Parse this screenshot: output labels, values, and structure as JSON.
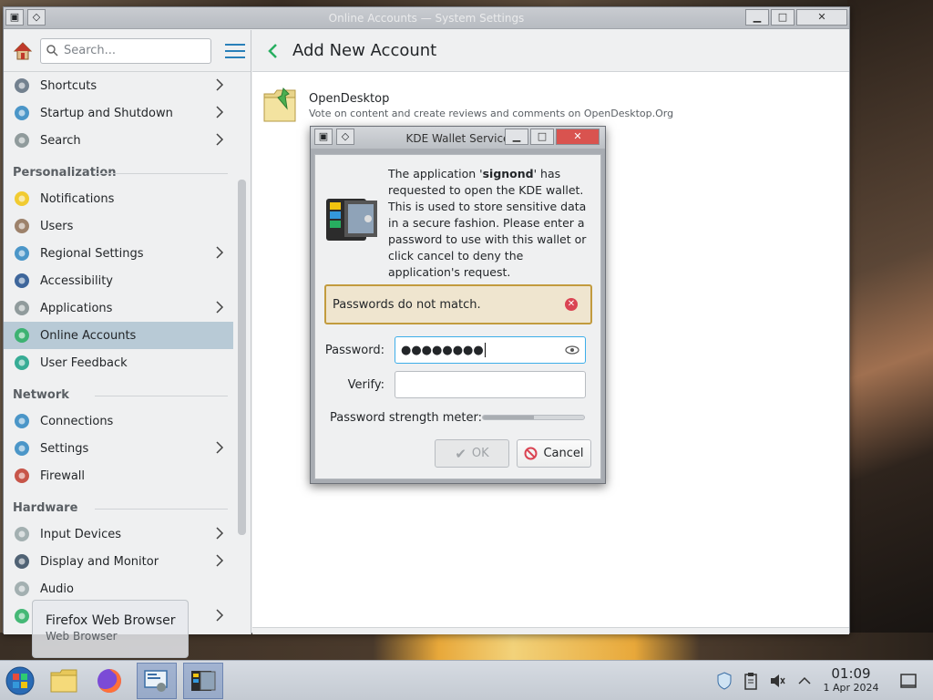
{
  "window": {
    "title": "Online Accounts — System Settings",
    "min_glyph": "▁",
    "max_glyph": "□",
    "close_glyph": "✕"
  },
  "sidebar": {
    "search_placeholder": "Search...",
    "items_top": [
      {
        "label": "Shortcuts",
        "chevron": true,
        "icon": "keyboard-icon"
      },
      {
        "label": "Startup and Shutdown",
        "chevron": true,
        "icon": "startup-icon"
      },
      {
        "label": "Search",
        "chevron": true,
        "icon": "search-icon"
      }
    ],
    "sections": [
      {
        "title": "Personalization",
        "items": [
          {
            "label": "Notifications",
            "chevron": false,
            "icon": "bell-icon"
          },
          {
            "label": "Users",
            "chevron": false,
            "icon": "users-icon"
          },
          {
            "label": "Regional Settings",
            "chevron": true,
            "icon": "globe-icon"
          },
          {
            "label": "Accessibility",
            "chevron": false,
            "icon": "accessibility-icon"
          },
          {
            "label": "Applications",
            "chevron": true,
            "icon": "applications-icon"
          },
          {
            "label": "Online Accounts",
            "chevron": false,
            "icon": "online-accounts-icon",
            "selected": true
          },
          {
            "label": "User Feedback",
            "chevron": false,
            "icon": "feedback-icon"
          }
        ]
      },
      {
        "title": "Network",
        "items": [
          {
            "label": "Connections",
            "chevron": false,
            "icon": "connections-icon"
          },
          {
            "label": "Settings",
            "chevron": true,
            "icon": "network-settings-icon"
          },
          {
            "label": "Firewall",
            "chevron": false,
            "icon": "firewall-icon"
          }
        ]
      },
      {
        "title": "Hardware",
        "items": [
          {
            "label": "Input Devices",
            "chevron": true,
            "icon": "mouse-icon"
          },
          {
            "label": "Display and Monitor",
            "chevron": true,
            "icon": "monitor-icon"
          },
          {
            "label": "Audio",
            "chevron": false,
            "icon": "audio-icon"
          },
          {
            "label": "",
            "chevron": true,
            "icon": "power-icon"
          }
        ]
      }
    ]
  },
  "content": {
    "title": "Add New Account",
    "provider_name": "OpenDesktop",
    "provider_desc": "Vote on content and create reviews and comments on OpenDesktop.Org"
  },
  "dialog": {
    "title": "KDE Wallet Service",
    "text_before": "The application '",
    "app_name": "signond",
    "text_after": "' has requested to open the KDE wallet. This is used to store sensitive data in a secure fashion. Please enter a password to use with this wallet or click cancel to deny the application's request.",
    "error": "Passwords do not match.",
    "password_label": "Password:",
    "password_value": "●●●●●●●●",
    "verify_label": "Verify:",
    "verify_value": "",
    "meter_label": "Password strength meter:",
    "meter_fraction": 0.5,
    "ok_label": "OK",
    "cancel_label": "Cancel"
  },
  "tooltip": {
    "title": "Firefox Web Browser",
    "subtitle": "Web Browser"
  },
  "taskbar": {
    "time": "01:09",
    "date": "1 Apr 2024"
  }
}
